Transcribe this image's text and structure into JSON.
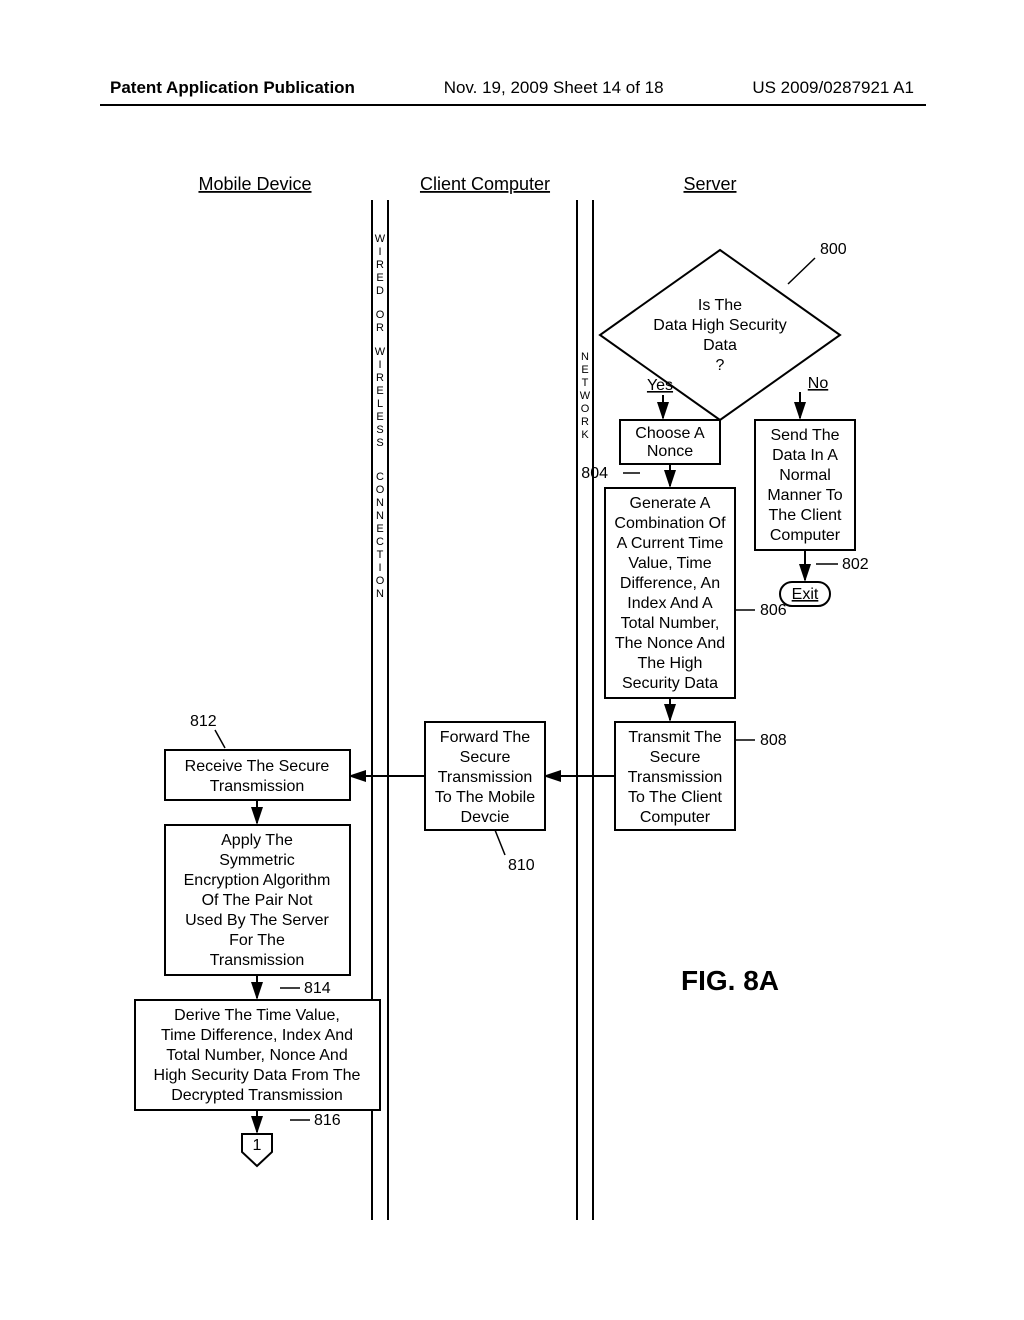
{
  "header": {
    "left": "Patent Application Publication",
    "center": "Nov. 19, 2009  Sheet 14 of 18",
    "right": "US 2009/0287921 A1"
  },
  "columns": {
    "mobile": "Mobile Device",
    "client": "Client Computer",
    "server": "Server"
  },
  "vlabels": {
    "v1": "WIRED OR WIRELESS CONNECTION",
    "v2": "NETWORK"
  },
  "decision": {
    "l1": "Is The",
    "l2": "Data High Security",
    "l3": "Data",
    "l4": "?",
    "yes": "Yes",
    "no": "No"
  },
  "boxes": {
    "b802": {
      "l1": "Send The",
      "l2": "Data In A",
      "l3": "Normal",
      "l4": "Manner To",
      "l5": "The Client",
      "l6": "Computer"
    },
    "exit": "Exit",
    "b804": {
      "l1": "Choose A",
      "l2": "Nonce"
    },
    "b806": {
      "l1": "Generate A",
      "l2": "Combination Of",
      "l3": "A Current Time",
      "l4": "Value, Time",
      "l5": "Difference, An",
      "l6": "Index And A",
      "l7": "Total Number,",
      "l8": "The Nonce And",
      "l9": "The High",
      "l10": "Security Data"
    },
    "b808": {
      "l1": "Transmit The",
      "l2": "Secure",
      "l3": "Transmission",
      "l4": "To The Client",
      "l5": "Computer"
    },
    "b810": {
      "l1": "Forward The",
      "l2": "Secure",
      "l3": "Transmission",
      "l4": "To The Mobile",
      "l5": "Devcie"
    },
    "b812": {
      "l1": "Receive The Secure",
      "l2": "Transmission"
    },
    "b814": {
      "l1": "Apply The",
      "l2": "Symmetric",
      "l3": "Encryption Algorithm",
      "l4": "Of The Pair Not",
      "l5": "Used By The Server",
      "l6": "For The",
      "l7": "Transmission"
    },
    "b816": {
      "l1": "Derive The Time Value,",
      "l2": "Time Difference, Index And",
      "l3": "Total Number, Nonce And",
      "l4": "High Security Data From The",
      "l5": "Decrypted Transmission"
    }
  },
  "labels": {
    "n800": "800",
    "n802": "802",
    "n804": "804",
    "n806": "806",
    "n808": "808",
    "n810": "810",
    "n812": "812",
    "n814": "814",
    "n816": "816",
    "conn": "1"
  },
  "figure": "FIG. 8A"
}
